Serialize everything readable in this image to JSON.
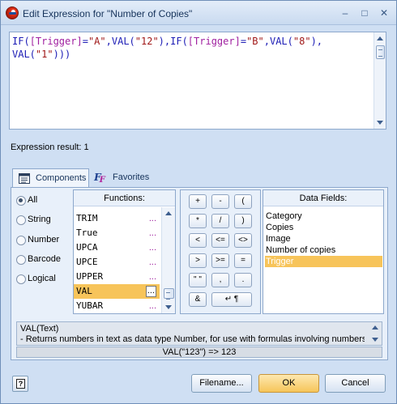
{
  "window": {
    "title": "Edit Expression for \"Number of Copies\"",
    "minimize_glyph": "–",
    "maximize_glyph": "□",
    "close_glyph": "✕"
  },
  "editor": {
    "expression_parts": [
      {
        "t": "IF(",
        "c": "kw"
      },
      {
        "t": "[Trigger]",
        "c": "fld"
      },
      {
        "t": "=",
        "c": "kw"
      },
      {
        "t": "\"A\"",
        "c": "str"
      },
      {
        "t": ",VAL(",
        "c": "kw"
      },
      {
        "t": "\"12\"",
        "c": "str"
      },
      {
        "t": "),IF(",
        "c": "kw"
      },
      {
        "t": "[Trigger]",
        "c": "fld"
      },
      {
        "t": "=",
        "c": "kw"
      },
      {
        "t": "\"B\"",
        "c": "str"
      },
      {
        "t": ",VAL(",
        "c": "kw"
      },
      {
        "t": "\"8\"",
        "c": "str"
      },
      {
        "t": "),\nVAL(",
        "c": "kw"
      },
      {
        "t": "\"1\"",
        "c": "str"
      },
      {
        "t": ")))",
        "c": "kw"
      }
    ]
  },
  "expression_result": "Expression result: 1",
  "tabs": {
    "components": "Components",
    "favorites": "Favorites"
  },
  "categories": [
    {
      "label": "All",
      "checked": true
    },
    {
      "label": "String",
      "checked": false
    },
    {
      "label": "Number",
      "checked": false
    },
    {
      "label": "Barcode",
      "checked": false
    },
    {
      "label": "Logical",
      "checked": false
    }
  ],
  "functions": {
    "header": "Functions:",
    "more_glyph": "...",
    "items": [
      {
        "name": "TRIM",
        "selected": false
      },
      {
        "name": "True",
        "selected": false
      },
      {
        "name": "UPCA",
        "selected": false
      },
      {
        "name": "UPCE",
        "selected": false
      },
      {
        "name": "UPPER",
        "selected": false
      },
      {
        "name": "VAL",
        "selected": true
      },
      {
        "name": "YUBAR",
        "selected": false
      }
    ]
  },
  "operators": [
    "+",
    "-",
    "(",
    "*",
    "/",
    ")",
    "<",
    "<=",
    "<>",
    ">",
    ">=",
    "=",
    "\" \"",
    ",",
    ".",
    "&",
    "↵ ¶"
  ],
  "data_fields": {
    "header": "Data Fields:",
    "items": [
      {
        "name": "Category",
        "selected": false
      },
      {
        "name": "Copies",
        "selected": false
      },
      {
        "name": "Image",
        "selected": false
      },
      {
        "name": "Number of copies",
        "selected": false
      },
      {
        "name": "Trigger",
        "selected": true
      }
    ]
  },
  "description": {
    "signature": "VAL(Text)",
    "text": "- Returns numbers in text as data type Number, for use with formulas involving numbers",
    "example": "VAL(\"123\") => 123"
  },
  "buttons": {
    "help": "?",
    "filename": "Filename...",
    "ok": "OK",
    "cancel": "Cancel"
  },
  "colors": {
    "accent_selection": "#f7c45a",
    "keyword": "#1b1bb5",
    "field": "#a020a0",
    "string": "#a01818"
  }
}
